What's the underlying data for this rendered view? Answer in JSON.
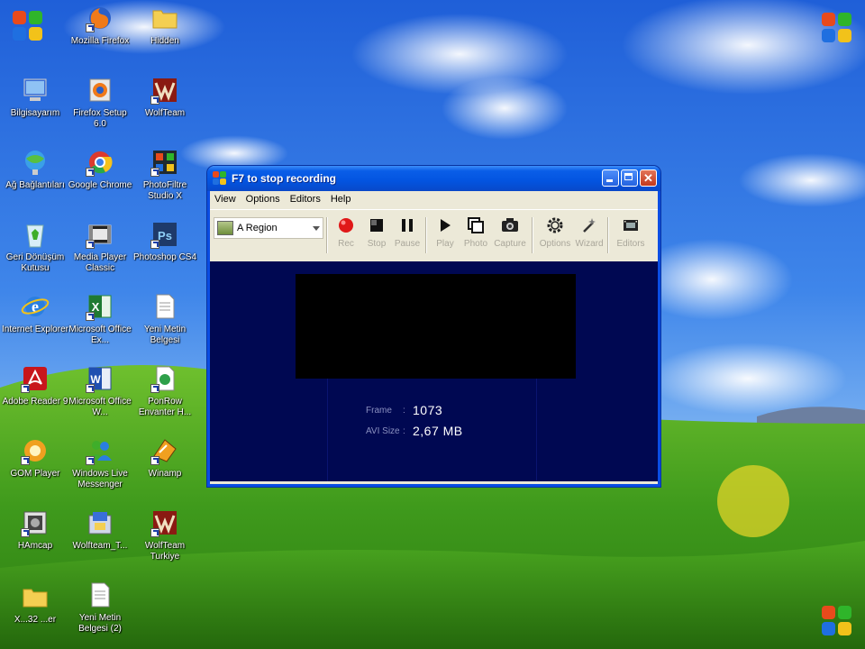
{
  "desktop": {
    "icons": [
      {
        "label": "",
        "icon": "windows-logo-icon"
      },
      {
        "label": "Mozilla Firefox",
        "icon": "firefox-icon"
      },
      {
        "label": "Hidden",
        "icon": "folder-icon"
      },
      {
        "label": "Bilgisayarım",
        "icon": "computer-icon"
      },
      {
        "label": "Firefox Setup 6.0",
        "icon": "firefox-setup-icon"
      },
      {
        "label": "WolfTeam",
        "icon": "wolfteam-icon"
      },
      {
        "label": "Ağ Bağlantıları",
        "icon": "network-icon"
      },
      {
        "label": "Google Chrome",
        "icon": "chrome-icon"
      },
      {
        "label": "PhotoFiltre Studio X",
        "icon": "photofiltre-icon"
      },
      {
        "label": "Geri Dönüşüm Kutusu",
        "icon": "recycle-bin-icon"
      },
      {
        "label": "Media Player Classic",
        "icon": "media-player-icon"
      },
      {
        "label": "Photoshop CS4",
        "icon": "photoshop-icon"
      },
      {
        "label": "Internet Explorer",
        "icon": "internet-explorer-icon"
      },
      {
        "label": "Microsoft Office Ex...",
        "icon": "excel-icon"
      },
      {
        "label": "Yeni Metin Belgesi",
        "icon": "text-document-icon"
      },
      {
        "label": "Adobe Reader 9",
        "icon": "adobe-reader-icon"
      },
      {
        "label": "Microsoft Office W...",
        "icon": "word-icon"
      },
      {
        "label": "PonRow Envanter H...",
        "icon": "ponrow-icon"
      },
      {
        "label": "GOM Player",
        "icon": "gom-player-icon"
      },
      {
        "label": "Windows Live Messenger",
        "icon": "messenger-icon"
      },
      {
        "label": "Winamp",
        "icon": "winamp-icon"
      },
      {
        "label": "HAmcap",
        "icon": "hamcap-icon"
      },
      {
        "label": "Wolfteam_T...",
        "icon": "wolfteam-installer-icon"
      },
      {
        "label": "WolfTeam Turkiye",
        "icon": "wolfteam-turkiye-icon"
      },
      {
        "label": "X...32 ...er",
        "icon": "folder-icon"
      },
      {
        "label": "Yeni Metin Belgesi (2)",
        "icon": "text-document-icon"
      }
    ]
  },
  "window": {
    "title": "F7 to stop recording",
    "menu": [
      "View",
      "Options",
      "Editors",
      "Help"
    ],
    "region_select": "A Region",
    "tools": [
      {
        "label": "Rec",
        "icon": "record-icon"
      },
      {
        "label": "Stop",
        "icon": "stop-icon"
      },
      {
        "label": "Pause",
        "icon": "pause-icon"
      },
      {
        "label": "Play",
        "icon": "play-icon"
      },
      {
        "label": "Photo",
        "icon": "photo-icon"
      },
      {
        "label": "Capture",
        "icon": "camera-icon"
      },
      {
        "label": "Options",
        "icon": "gear-icon"
      },
      {
        "label": "Wizard",
        "icon": "wizard-icon"
      },
      {
        "label": "Editors",
        "icon": "film-icon"
      }
    ],
    "stats": {
      "frame_label": "Frame",
      "frame_sep": ":",
      "frame_value": "1073",
      "avi_label": "AVI Size",
      "avi_sep": ":",
      "avi_value": "2,67 MB"
    }
  },
  "colors": {
    "accent": "#0a5ee8",
    "preview_bg": "#000852",
    "record": "#e01818",
    "click_indicator": "#e8d628"
  }
}
